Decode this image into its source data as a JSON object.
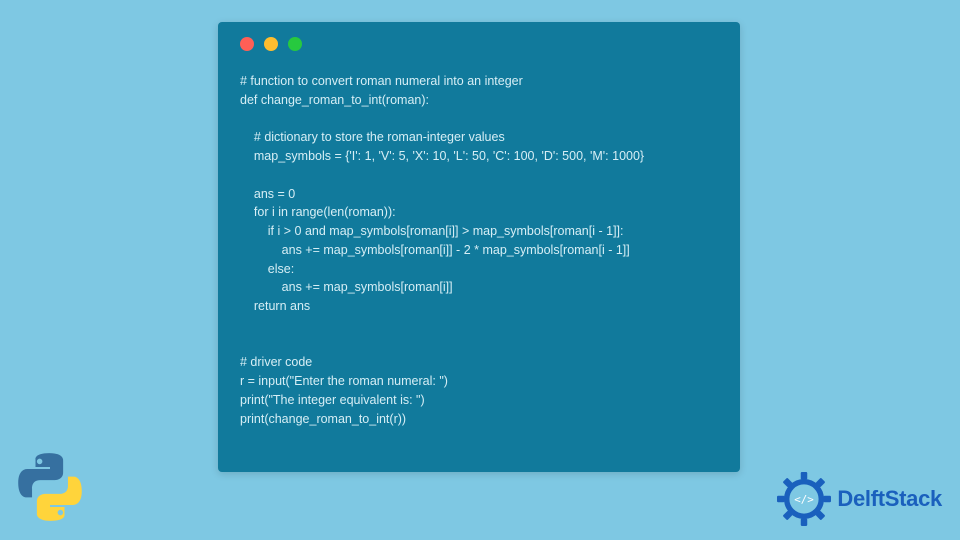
{
  "code": {
    "lines": [
      "# function to convert roman numeral into an integer",
      "def change_roman_to_int(roman):",
      "",
      "    # dictionary to store the roman-integer values",
      "    map_symbols = {'I': 1, 'V': 5, 'X': 10, 'L': 50, 'C': 100, 'D': 500, 'M': 1000}",
      "",
      "    ans = 0",
      "    for i in range(len(roman)):",
      "        if i > 0 and map_symbols[roman[i]] > map_symbols[roman[i - 1]]:",
      "            ans += map_symbols[roman[i]] - 2 * map_symbols[roman[i - 1]]",
      "        else:",
      "            ans += map_symbols[roman[i]]",
      "    return ans",
      "",
      "",
      "# driver code",
      "r = input(\"Enter the roman numeral: \")",
      "print(\"The integer equivalent is: \")",
      "print(change_roman_to_int(r))"
    ]
  },
  "branding": {
    "site_name": "DelftStack"
  },
  "window": {
    "dots": [
      "red",
      "yellow",
      "green"
    ]
  }
}
